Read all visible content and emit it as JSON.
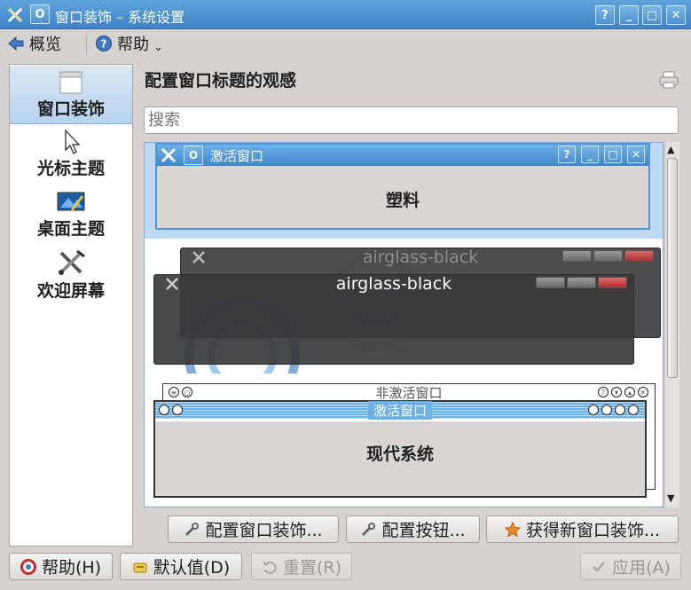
{
  "window": {
    "title": "窗口装饰 – 系统设置",
    "buttons": {
      "help": "?",
      "minimize": "_",
      "maximize": "□",
      "close": "✕"
    }
  },
  "toolbar": {
    "overview_label": "概览",
    "help_label": "帮助",
    "help_dropdown": "⌄"
  },
  "sidebar": {
    "items": [
      {
        "label": "窗口装饰",
        "icon": "window-icon",
        "selected": true
      },
      {
        "label": "光标主题",
        "icon": "cursor-icon",
        "selected": false
      },
      {
        "label": "桌面主题",
        "icon": "desktop-icon",
        "selected": false
      },
      {
        "label": "欢迎屏幕",
        "icon": "tools-icon",
        "selected": false
      }
    ]
  },
  "main": {
    "heading": "配置窗口标题的观感",
    "search_placeholder": "搜索"
  },
  "decorations": [
    {
      "name": "塑料",
      "active_title": "激活窗口",
      "selected": true
    },
    {
      "name": "airglass-black",
      "inactive_title": "airglass-black",
      "active_title": "airglass-black"
    },
    {
      "name": "现代系统",
      "inactive_title": "非激活窗口",
      "active_title": "激活窗口"
    }
  ],
  "actions": {
    "configure_decoration": "配置窗口装饰...",
    "configure_buttons": "配置按钮...",
    "get_new": "获得新窗口装饰..."
  },
  "footer": {
    "help": "帮助(H)",
    "defaults": "默认值(D)",
    "reset": "重置(R)",
    "apply": "应用(A)"
  },
  "colors": {
    "titlebar": "#4a8fd0",
    "selection": "#bfd9f2",
    "airglass_close": "#c04040"
  }
}
